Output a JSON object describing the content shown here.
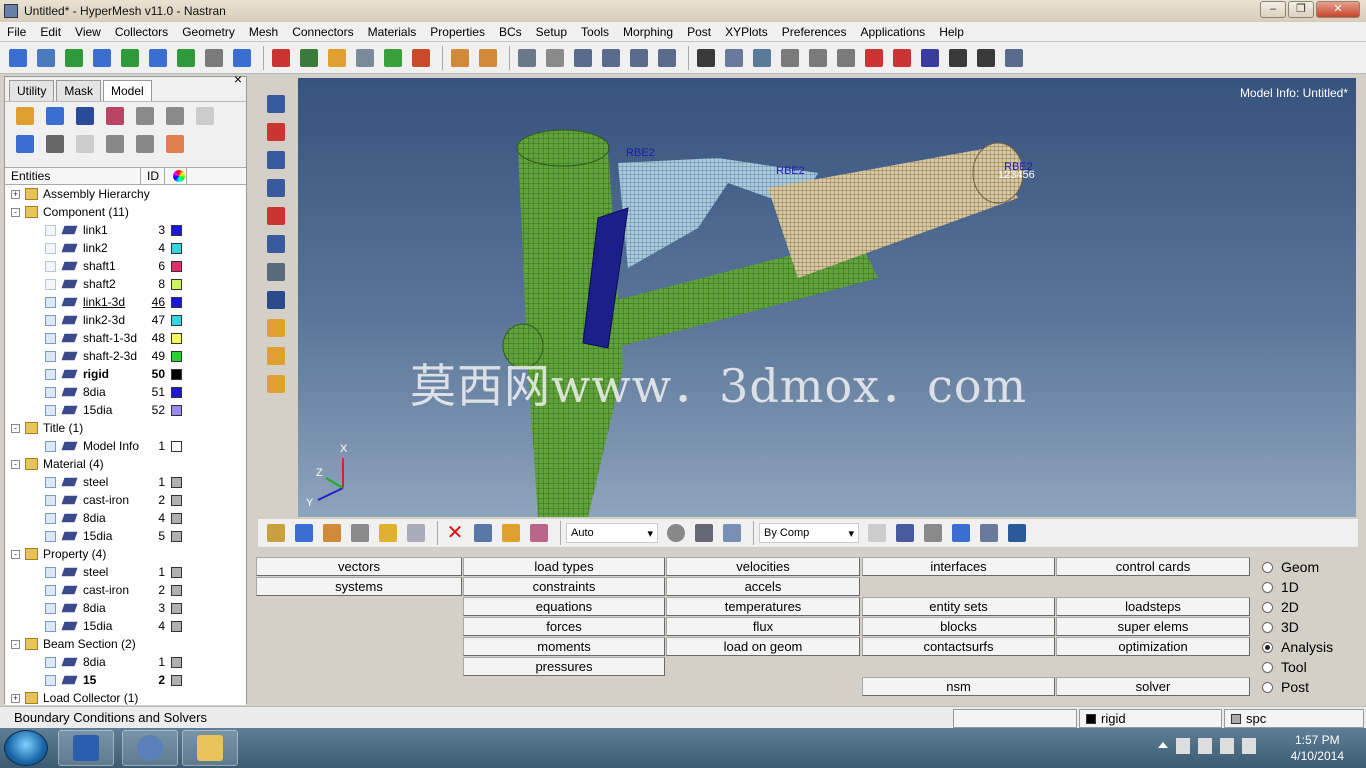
{
  "window": {
    "title": "Untitled* - HyperMesh v11.0 - Nastran"
  },
  "menu": [
    "File",
    "Edit",
    "View",
    "Collectors",
    "Geometry",
    "Mesh",
    "Connectors",
    "Materials",
    "Properties",
    "BCs",
    "Setup",
    "Tools",
    "Morphing",
    "Post",
    "XYPlots",
    "Preferences",
    "Applications",
    "Help"
  ],
  "browser": {
    "tabs": [
      "Utility",
      "Mask",
      "Model"
    ],
    "active_tab": "Model",
    "columns": {
      "entities": "Entities",
      "id": "ID"
    },
    "rows": [
      {
        "label": "Assembly Hierarchy",
        "level": 0,
        "exp": "+"
      },
      {
        "label": "Component (11)",
        "level": 0,
        "exp": "-"
      },
      {
        "label": "link1",
        "id": "3",
        "color": "#1a1acc",
        "level": 1,
        "vis": "light"
      },
      {
        "label": "link2",
        "id": "4",
        "color": "#33d6e0",
        "level": 1,
        "vis": "light"
      },
      {
        "label": "shaft1",
        "id": "6",
        "color": "#d6336b",
        "level": 1,
        "vis": "light"
      },
      {
        "label": "shaft2",
        "id": "8",
        "color": "#ccf066",
        "level": 1,
        "vis": "light"
      },
      {
        "label": "link1-3d",
        "id": "46",
        "color": "#1a1acc",
        "level": 1,
        "underline": true
      },
      {
        "label": "link2-3d",
        "id": "47",
        "color": "#33d6e0",
        "level": 1
      },
      {
        "label": "shaft-1-3d",
        "id": "48",
        "color": "#f5f566",
        "level": 1
      },
      {
        "label": "shaft-2-3d",
        "id": "49",
        "color": "#33cc33",
        "level": 1
      },
      {
        "label": "rigid",
        "id": "50",
        "color": "#000000",
        "level": 1,
        "bold": true
      },
      {
        "label": "8dia",
        "id": "51",
        "color": "#1a1acc",
        "level": 1
      },
      {
        "label": "15dia",
        "id": "52",
        "color": "#9b88f0",
        "level": 1
      },
      {
        "label": "Title (1)",
        "level": 0,
        "exp": "-"
      },
      {
        "label": "Model Info",
        "id": "1",
        "color": "#ffffff",
        "level": 1
      },
      {
        "label": "Material (4)",
        "level": 0,
        "exp": "-"
      },
      {
        "label": "steel",
        "id": "1",
        "color": "#b0b0b0",
        "level": 1
      },
      {
        "label": "cast-iron",
        "id": "2",
        "color": "#b0b0b0",
        "level": 1
      },
      {
        "label": "8dia",
        "id": "4",
        "color": "#b0b0b0",
        "level": 1
      },
      {
        "label": "15dia",
        "id": "5",
        "color": "#b0b0b0",
        "level": 1
      },
      {
        "label": "Property (4)",
        "level": 0,
        "exp": "-"
      },
      {
        "label": "steel",
        "id": "1",
        "color": "#b0b0b0",
        "level": 1
      },
      {
        "label": "cast-iron",
        "id": "2",
        "color": "#b0b0b0",
        "level": 1
      },
      {
        "label": "8dia",
        "id": "3",
        "color": "#b0b0b0",
        "level": 1
      },
      {
        "label": "15dia",
        "id": "4",
        "color": "#b0b0b0",
        "level": 1
      },
      {
        "label": "Beam Section (2)",
        "level": 0,
        "exp": "-"
      },
      {
        "label": "8dia",
        "id": "1",
        "color": "#b0b0b0",
        "level": 1
      },
      {
        "label": "15",
        "id": "2",
        "color": "#b0b0b0",
        "level": 1,
        "bold": true
      },
      {
        "label": "Load Collector (1)",
        "level": 0,
        "exp": "+"
      }
    ]
  },
  "viewport": {
    "model_info": "Model Info: Untitled*",
    "watermark": "莫西网www．3dmox．com",
    "labels": [
      "RBE2",
      "RBE2",
      "RBE2",
      "123456"
    ],
    "axes": [
      "X",
      "Y",
      "Z"
    ]
  },
  "bottom_toolbar": {
    "auto_label": "Auto",
    "color_mode": "By Comp"
  },
  "panel": {
    "col1": [
      "vectors",
      "systems"
    ],
    "col2": [
      "load types",
      "constraints",
      "equations",
      "forces",
      "moments",
      "pressures"
    ],
    "col3": [
      "velocities",
      "accels",
      "temperatures",
      "flux",
      "load on geom"
    ],
    "col4": [
      "interfaces",
      "",
      "entity sets",
      "blocks",
      "contactsurfs",
      "",
      "nsm"
    ],
    "col5": [
      "control cards",
      "",
      "loadsteps",
      "super elems",
      "optimization",
      "",
      "solver"
    ],
    "modes": [
      "Geom",
      "1D",
      "2D",
      "3D",
      "Analysis",
      "Tool",
      "Post"
    ],
    "selected_mode": "Analysis"
  },
  "status": {
    "text": "Boundary Conditions and Solvers",
    "component": "rigid",
    "loadcol": "spc"
  },
  "taskbar": {
    "time": "1:57 PM",
    "date": "4/10/2014"
  }
}
